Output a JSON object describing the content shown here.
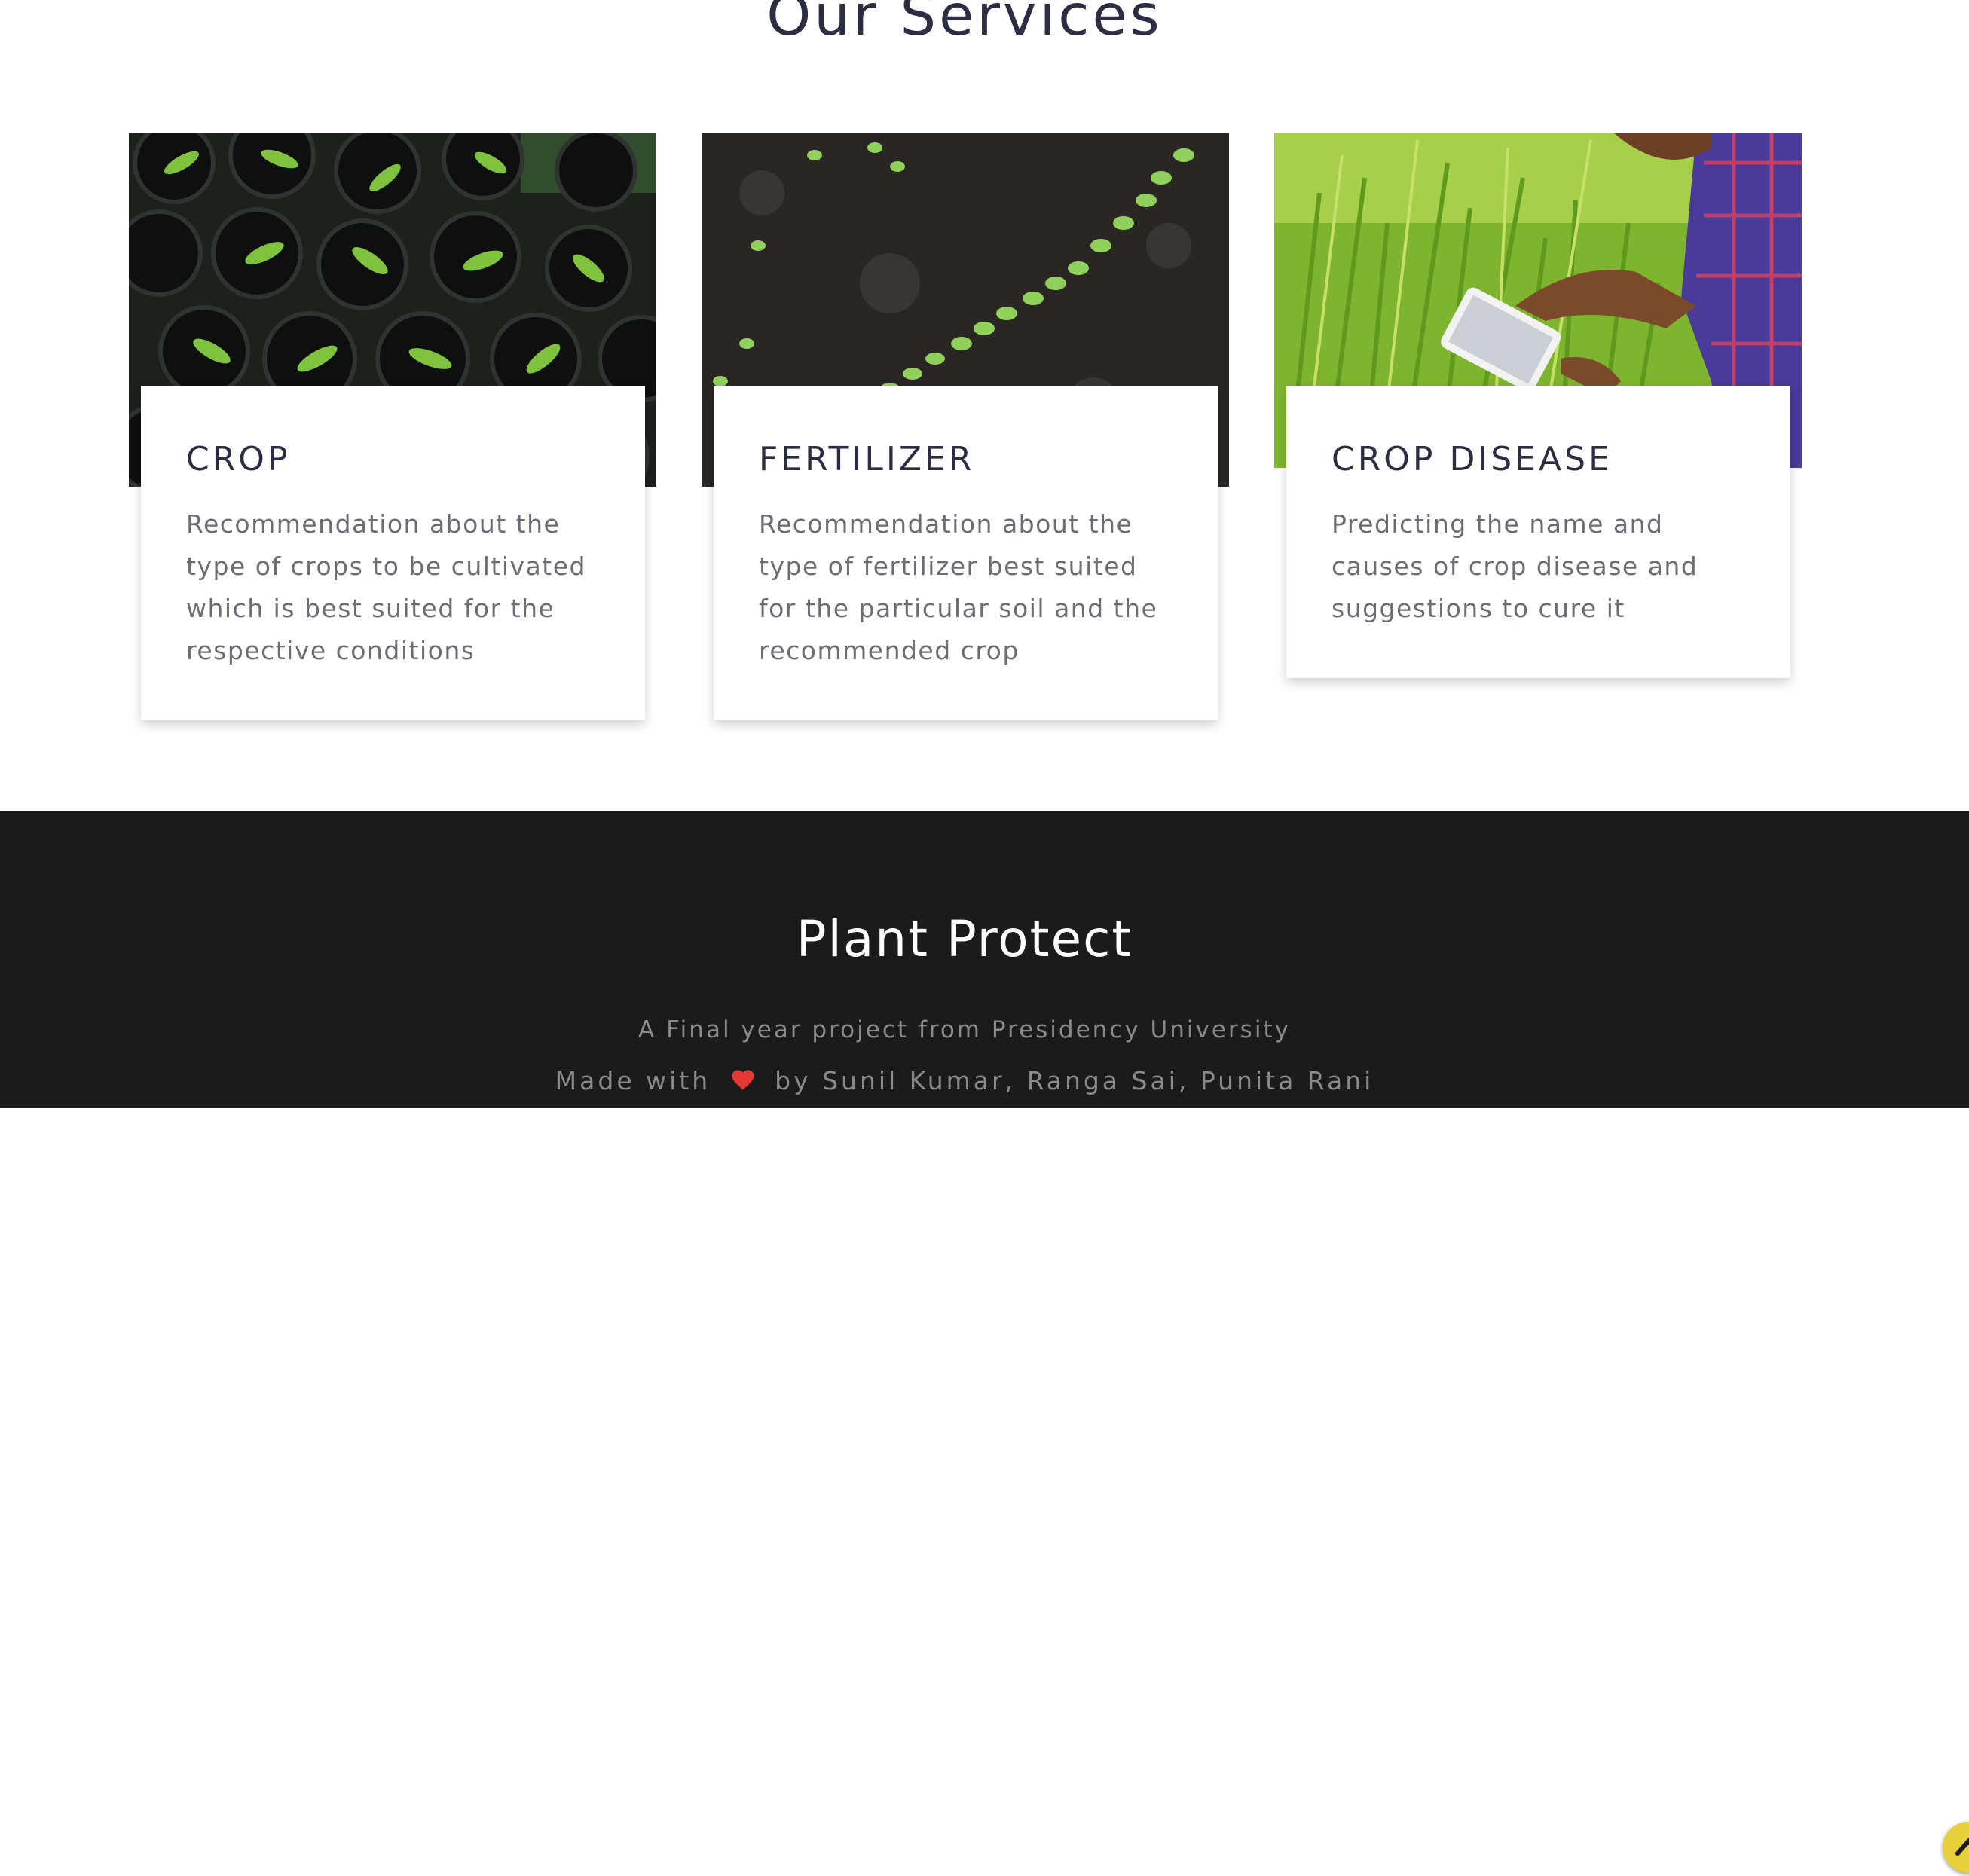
{
  "services": {
    "title": "Our Services",
    "cards": [
      {
        "title": "CROP",
        "text": "Recommendation about the type of crops to be cultivated which is best suited for the respective conditions",
        "image": "potted-seedlings-image"
      },
      {
        "title": "FERTILIZER",
        "text": "Recommendation about the type of fertilizer best suited for the particular soil and the recommended crop",
        "image": "soil-sprouts-image"
      },
      {
        "title": "CROP DISEASE",
        "text": "Predicting the name and causes of crop disease and suggestions to cure it",
        "image": "farmer-with-tablet-image"
      }
    ]
  },
  "footer": {
    "title": "Plant Protect",
    "subtitle": "A Final year project from Presidency University",
    "credits_prefix": "Made with",
    "credits_icon": "heart-icon",
    "credits_suffix": "by Sunil Kumar, Ranga Sai, Punita Rani"
  },
  "scroll_top": {
    "icon": "chevron-up-icon"
  },
  "colors": {
    "heading": "#2b2d42",
    "body_text": "#6c6c76",
    "footer_bg": "#1b1b1c",
    "footer_text": "#8a8a8a",
    "accent": "#e8d03a",
    "heart": "#e53935"
  }
}
